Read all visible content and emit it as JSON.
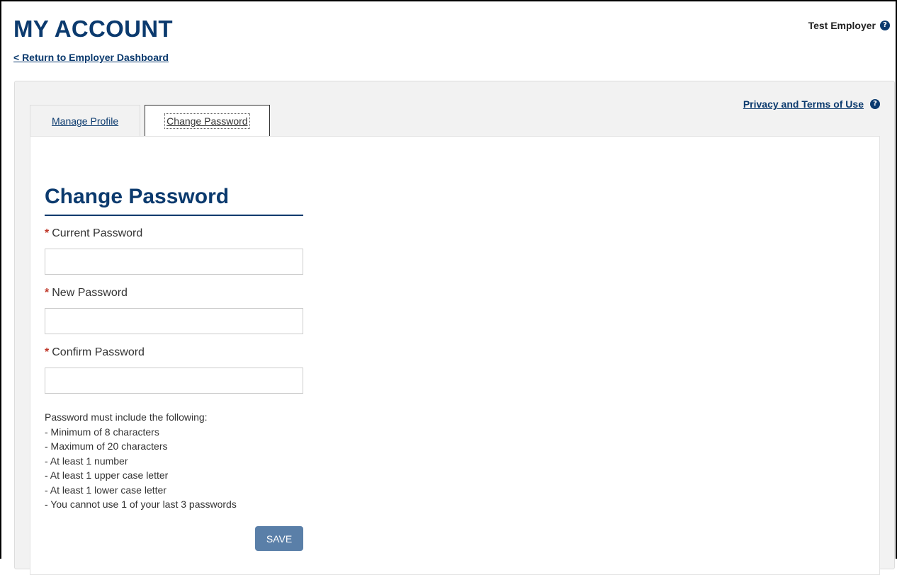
{
  "header": {
    "title": "MY ACCOUNT",
    "return_link": "< Return to Employer Dashboard",
    "user_name": "Test Employer",
    "help_icon": "question-circle-icon"
  },
  "panel": {
    "privacy_link": "Privacy and Terms of Use",
    "tabs": [
      {
        "label": "Manage Profile",
        "active": false
      },
      {
        "label": "Change Password",
        "active": true
      }
    ]
  },
  "form": {
    "title": "Change Password",
    "required_marker": "*",
    "fields": [
      {
        "label": "Current Password",
        "value": ""
      },
      {
        "label": "New Password",
        "value": ""
      },
      {
        "label": "Confirm Password",
        "value": ""
      }
    ],
    "rules": [
      "Password must include the following:",
      "- Minimum of 8 characters",
      "- Maximum of 20 characters",
      "- At least 1 number",
      "- At least 1 upper case letter",
      "- At least 1 lower case letter",
      "- You cannot use 1 of your last 3 passwords"
    ],
    "save_label": "SAVE"
  },
  "colors": {
    "brand": "#0b3a6e",
    "required": "#c0392b",
    "button": "#5a7fa8"
  }
}
